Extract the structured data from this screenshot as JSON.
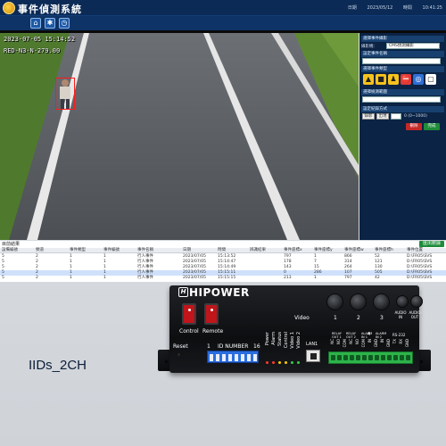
{
  "header": {
    "app_title": "事件偵測系統",
    "date_label": "日期",
    "date": "2023/05/12",
    "time_label": "時間",
    "time": "10:41:25"
  },
  "toolbar": {
    "icons": [
      "home-icon",
      "settings-icon",
      "history-icon"
    ]
  },
  "video": {
    "osd_timestamp": "2023-07-05 15:14:52",
    "osd_location": "RED-N3-N-279.00"
  },
  "panel": {
    "section_camera": "選擇事件攝影",
    "camera_label": "攝影機：",
    "camera_value": "CMS偵測攝影",
    "section_event_name": "設定事件名稱",
    "section_event_type": "選擇事件類型",
    "section_detect": "選擇檢測範圍",
    "section_record": "設定紀錄方式",
    "save_label": "儲存",
    "cancel_label": "取消",
    "complete_label": "完成",
    "delete_label": "刪除",
    "range_label": "0 (0~1000)",
    "rec_label": "錄影",
    "output_label": "出現"
  },
  "table": {
    "title": "目前結果",
    "export_label": "匯出數據",
    "headers": [
      "設備編號",
      "頻道",
      "事件類型",
      "事件編號",
      "事件名稱",
      "日期",
      "時間",
      "辨識結果",
      "事件座標x",
      "事件座標y",
      "事件座標w",
      "事件座標h",
      "事件位置"
    ],
    "rows": [
      [
        "5",
        "2",
        "1",
        "1",
        "行人事件",
        "2023/07/05",
        "15:13:52",
        "",
        "797",
        "1",
        "866",
        "52",
        "D:\\FR05\\SVS"
      ],
      [
        "5",
        "2",
        "1",
        "1",
        "行人事件",
        "2023/07/05",
        "15:14:47",
        "",
        "178",
        "7",
        "314",
        "121",
        "D:\\FR05\\SVS"
      ],
      [
        "5",
        "2",
        "1",
        "1",
        "行人事件",
        "2023/07/05",
        "15:14:49",
        "",
        "143",
        "15",
        "264",
        "130",
        "D:\\FR05\\SVS"
      ],
      [
        "5",
        "2",
        "1",
        "1",
        "行人事件",
        "2023/07/05",
        "15:15:11",
        "",
        "0",
        "286",
        "107",
        "505",
        "D:\\FR05\\SVS"
      ],
      [
        "5",
        "2",
        "1",
        "1",
        "行人事件",
        "2023/07/05",
        "15:15:15",
        "",
        "213",
        "1",
        "797",
        "42",
        "D:\\FR05\\SVS"
      ]
    ]
  },
  "device": {
    "brand": "HIPOWER",
    "control_label": "Control",
    "remote_label": "Remote",
    "video_label": "Video",
    "video_numbers": [
      "1",
      "2",
      "3",
      "4"
    ],
    "audio_in_label": "AUDIO IN",
    "audio_out_label": "AUDIO OUT",
    "reset_label": "Reset",
    "id_number_label": "ID NUMBER",
    "id_start": "1",
    "id_end": "16",
    "led_labels": [
      "Power",
      "Alarm",
      "Status",
      "Control",
      "Video 1",
      "Video 2"
    ],
    "lan_label": "LAN1",
    "relay_out1_label": "RELAY OUT 1",
    "relay_out2_label": "RELAY OUT 2",
    "alarm_in1_label": "ALARM IN 1",
    "alarm_in2_label": "ALARM IN 2",
    "rs232_label": "RS-232",
    "terminal_labels": [
      "NC",
      "NO",
      "COM",
      "NC",
      "NO",
      "COM",
      "IN",
      "GND",
      "IN",
      "GND",
      "TX",
      "RX",
      "GND"
    ]
  },
  "product_label": "IIDs_2CH",
  "colors": {
    "header_bg": "#0b2a55",
    "panel_bg": "#0b2344",
    "detect_box": "#ff1a1a",
    "rocker_red": "#c0151b",
    "dip_blue": "#2a6de0",
    "terminal_green": "#2db34a"
  }
}
